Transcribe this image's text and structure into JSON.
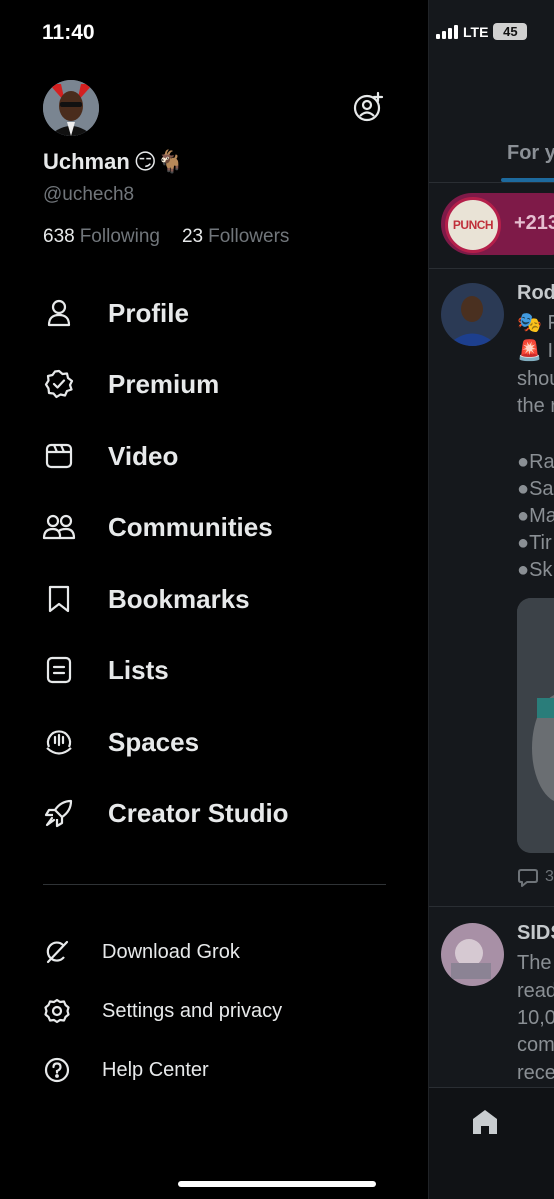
{
  "status_bar": {
    "time": "11:40",
    "network": "LTE",
    "battery": "45"
  },
  "profile": {
    "name": "Uchman",
    "name_emoji": "😏🐐",
    "handle": "@uchech8",
    "following_count": "638",
    "following_label": "Following",
    "followers_count": "23",
    "followers_label": "Followers"
  },
  "nav": {
    "profile": "Profile",
    "premium": "Premium",
    "video": "Video",
    "communities": "Communities",
    "bookmarks": "Bookmarks",
    "lists": "Lists",
    "spaces": "Spaces",
    "creator_studio": "Creator Studio"
  },
  "secondary": {
    "grok": "Download Grok",
    "settings": "Settings and privacy",
    "help": "Help Center"
  },
  "feed": {
    "tab_label": "For y",
    "punch_logo": "PUNCH",
    "punch_count": "+213",
    "post1_name": "Rod",
    "post1_lines": [
      "🎭 F",
      "🚨 I",
      "shou",
      "the r",
      "",
      "●Ra",
      "●Sa",
      "●Ma",
      "●Tir",
      "●Sk"
    ],
    "post1_reply_count": "3",
    "post2_name": "SIDS",
    "post2_lines": [
      "The",
      "read",
      "10,0",
      "com",
      "rece"
    ]
  },
  "colors": {
    "background": "#000000",
    "text_primary": "#e7e9ea",
    "text_secondary": "#71767b",
    "accent": "#1d9bf0"
  }
}
